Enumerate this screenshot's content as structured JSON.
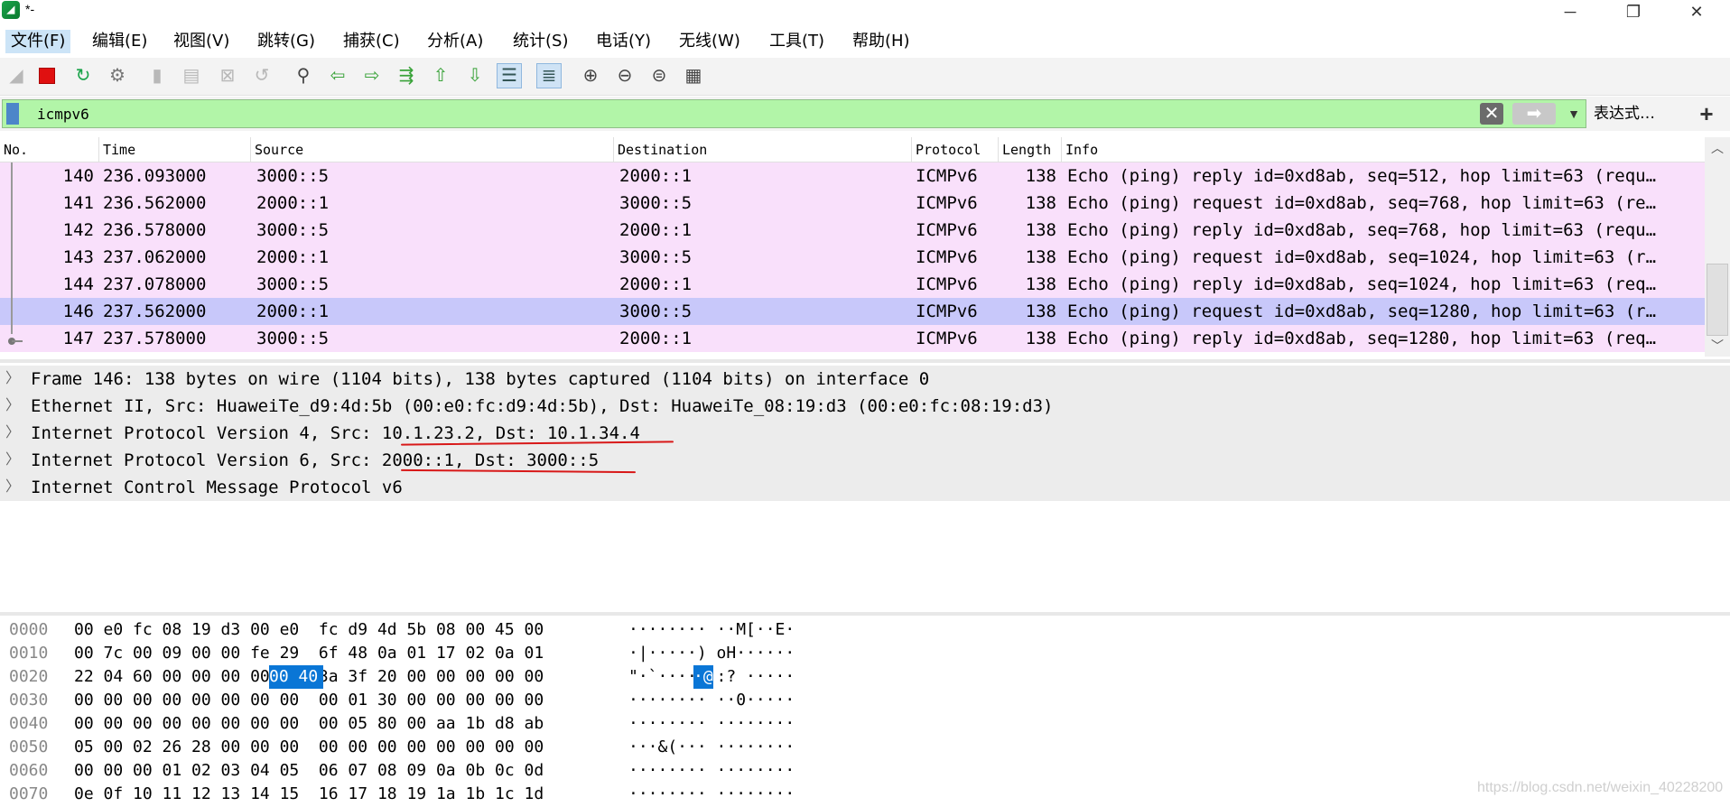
{
  "window": {
    "title": "*-",
    "minimize_icon": "minimize-icon",
    "restore_icon": "restore-icon",
    "close_icon": "close-icon"
  },
  "menu": [
    "文件(F)",
    "编辑(E)",
    "视图(V)",
    "跳转(G)",
    "捕获(C)",
    "分析(A)",
    "统计(S)",
    "电话(Y)",
    "无线(W)",
    "工具(T)",
    "帮助(H)"
  ],
  "toolbar_icons": [
    "shark-fin-start-icon",
    "stop-capture-icon",
    "restart-capture-icon",
    "capture-options-icon",
    "open-file-icon",
    "save-file-icon",
    "close-file-icon",
    "reload-file-icon",
    "find-packet-icon",
    "go-back-icon",
    "go-forward-icon",
    "go-to-packet-icon",
    "go-first-icon",
    "go-last-icon",
    "autoscroll-icon",
    "colorize-icon",
    "zoom-in-icon",
    "zoom-out-icon",
    "zoom-normal-icon",
    "resize-columns-icon"
  ],
  "filter": {
    "value": "icmpv6",
    "expression_label": "表达式…",
    "add_label": "+"
  },
  "packet_list": {
    "columns": [
      "No.",
      "Time",
      "Source",
      "Destination",
      "Protocol",
      "Length",
      "Info"
    ],
    "rows": [
      {
        "no": "140",
        "time": "236.093000",
        "src": "3000::5",
        "dst": "2000::1",
        "proto": "ICMPv6",
        "len": "138",
        "info": "Echo (ping) reply id=0xd8ab, seq=512, hop limit=63 (requ…"
      },
      {
        "no": "141",
        "time": "236.562000",
        "src": "2000::1",
        "dst": "3000::5",
        "proto": "ICMPv6",
        "len": "138",
        "info": "Echo (ping) request id=0xd8ab, seq=768, hop limit=63 (re…"
      },
      {
        "no": "142",
        "time": "236.578000",
        "src": "3000::5",
        "dst": "2000::1",
        "proto": "ICMPv6",
        "len": "138",
        "info": "Echo (ping) reply id=0xd8ab, seq=768, hop limit=63 (requ…"
      },
      {
        "no": "143",
        "time": "237.062000",
        "src": "2000::1",
        "dst": "3000::5",
        "proto": "ICMPv6",
        "len": "138",
        "info": "Echo (ping) request id=0xd8ab, seq=1024, hop limit=63 (r…"
      },
      {
        "no": "144",
        "time": "237.078000",
        "src": "3000::5",
        "dst": "2000::1",
        "proto": "ICMPv6",
        "len": "138",
        "info": "Echo (ping) reply id=0xd8ab, seq=1024, hop limit=63 (req…"
      },
      {
        "no": "146",
        "time": "237.562000",
        "src": "2000::1",
        "dst": "3000::5",
        "proto": "ICMPv6",
        "len": "138",
        "info": "Echo (ping) request id=0xd8ab, seq=1280, hop limit=63 (r…"
      },
      {
        "no": "147",
        "time": "237.578000",
        "src": "3000::5",
        "dst": "2000::1",
        "proto": "ICMPv6",
        "len": "138",
        "info": "Echo (ping) reply id=0xd8ab, seq=1280, hop limit=63 (req…"
      }
    ],
    "selected_no": "146"
  },
  "details": [
    "Frame 146: 138 bytes on wire (1104 bits), 138 bytes captured (1104 bits) on interface 0",
    "Ethernet II, Src: HuaweiTe_d9:4d:5b (00:e0:fc:d9:4d:5b), Dst: HuaweiTe_08:19:d3 (00:e0:fc:08:19:d3)",
    "Internet Protocol Version 4, Src: 10.1.23.2, Dst: 10.1.34.4",
    "Internet Protocol Version 6, Src: 2000::1, Dst: 3000::5",
    "Internet Control Message Protocol v6"
  ],
  "hex": [
    {
      "offset": "0000",
      "bytes": "00 e0 fc 08 19 d3 00 e0  fc d9 4d 5b 08 00 45 00",
      "ascii": "········ ··M[··E·"
    },
    {
      "offset": "0010",
      "bytes": "00 7c 00 09 00 00 fe 29  6f 48 0a 01 17 02 0a 01",
      "ascii": "·|·····) oH······"
    },
    {
      "offset": "0020",
      "bytes": "22 04 60 00 00 00 00 40  3a 3f 20 00 00 00 00 00",
      "ascii": "\"·`····@ :? ·····"
    },
    {
      "offset": "0030",
      "bytes": "00 00 00 00 00 00 00 00  00 01 30 00 00 00 00 00",
      "ascii": "········ ··0·····"
    },
    {
      "offset": "0040",
      "bytes": "00 00 00 00 00 00 00 00  00 05 80 00 aa 1b d8 ab",
      "ascii": "········ ········"
    },
    {
      "offset": "0050",
      "bytes": "05 00 02 26 28 00 00 00  00 00 00 00 00 00 00 00",
      "ascii": "···&(··· ········"
    },
    {
      "offset": "0060",
      "bytes": "00 00 00 01 02 03 04 05  06 07 08 09 0a 0b 0c 0d",
      "ascii": "········ ········"
    },
    {
      "offset": "0070",
      "bytes": "0e 0f 10 11 12 13 14 15  16 17 18 19 1a 1b 1c 1d",
      "ascii": "········ ········"
    }
  ],
  "hex_highlight": {
    "bytes": "00 40",
    "ascii": "·@"
  },
  "watermark": "https://blog.csdn.net/weixin_40228200",
  "colors": {
    "row_bg": "#f9e0fb",
    "row_selected": "#c8c8fa",
    "filter_bg": "#b2f5a8",
    "underline": "#d81818",
    "hex_highlight": "#0a76d6"
  }
}
